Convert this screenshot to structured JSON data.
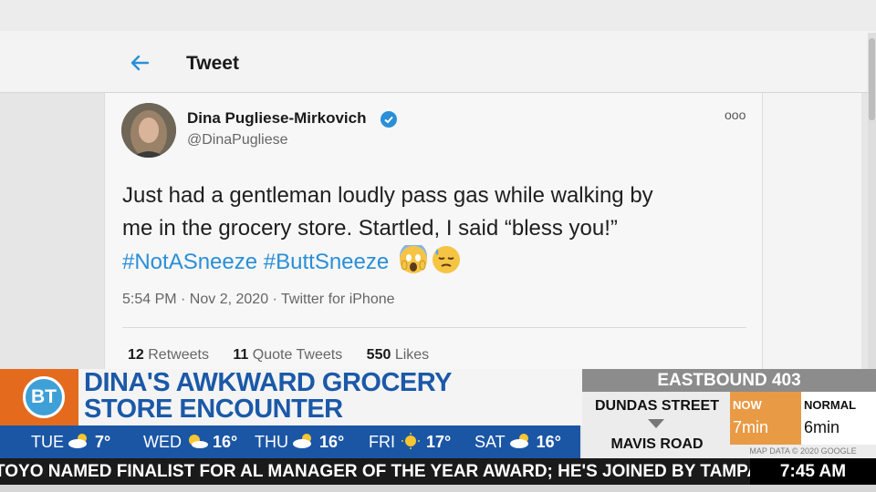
{
  "tweet_page": {
    "header_title": "Tweet",
    "author_name": "Dina Pugliese-Mirkovich",
    "author_handle": "@DinaPugliese",
    "more_label": "ooo",
    "text_line1": "Just had a gentleman loudly pass gas while walking by",
    "text_line2": "me in the grocery store. Startled, I said “bless you!”",
    "hashtag1": "#NotASneeze",
    "hashtag2": "#ButtSneeze",
    "timestamp": "5:54 PM · Nov 2, 2020 · Twitter for iPhone",
    "stats": [
      {
        "count": "12",
        "label": "Retweets"
      },
      {
        "count": "11",
        "label": "Quote Tweets"
      },
      {
        "count": "550",
        "label": "Likes"
      }
    ],
    "accent_color": "#2a8fd7"
  },
  "broadcast": {
    "logo_text": "BT",
    "headline_line1": "DINA'S AWKWARD GROCERY",
    "headline_line2": "STORE ENCOUNTER",
    "weather": [
      {
        "day": "TUE",
        "icon": "cloud-sun-icon",
        "temp": "7°"
      },
      {
        "day": "WED",
        "icon": "sun-cloud-icon",
        "temp": "16°"
      },
      {
        "day": "THU",
        "icon": "cloud-sun-icon",
        "temp": "16°"
      },
      {
        "day": "FRI",
        "icon": "sun-icon",
        "temp": "17°"
      },
      {
        "day": "SAT",
        "icon": "cloud-sun-icon",
        "temp": "16°"
      }
    ],
    "traffic": {
      "route": "EASTBOUND 403",
      "from": "DUNDAS STREET",
      "to": "MAVIS ROAD",
      "now_label": "NOW",
      "now_value": "7min",
      "normal_label": "NORMAL",
      "normal_value": "6min",
      "credit": "MAP DATA © 2020 GOOGLE"
    },
    "ticker": "TOYO NAMED FINALIST FOR AL MANAGER OF THE YEAR AWARD; HE'S JOINED BY TAMPA",
    "clock": "7:45 AM",
    "brand_orange": "#e46b1e",
    "brand_blue": "#1b56a5"
  }
}
